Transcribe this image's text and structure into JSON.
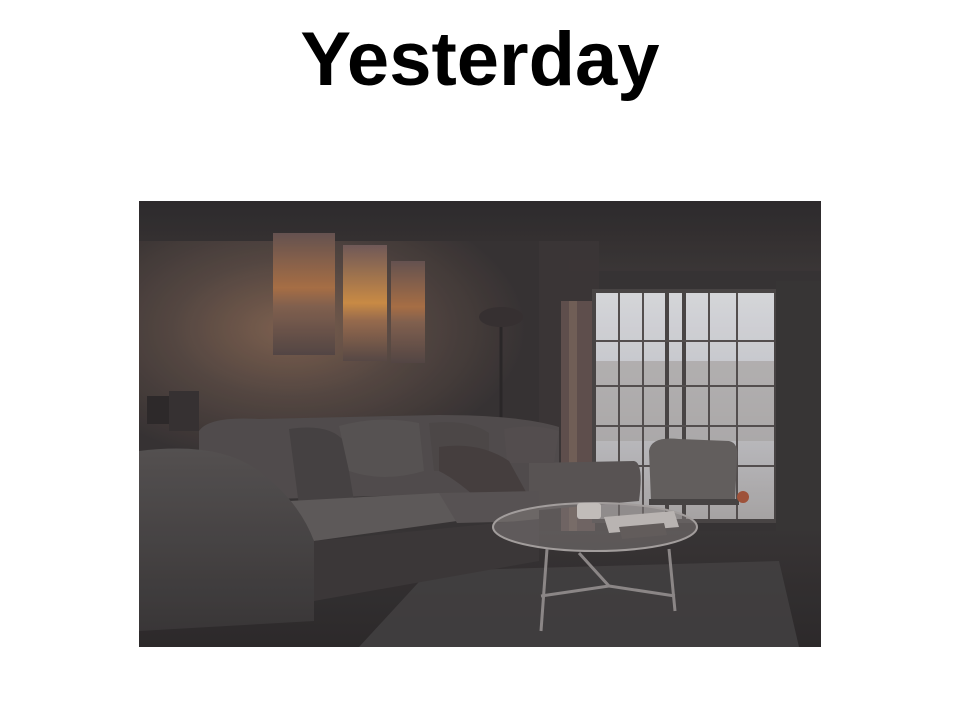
{
  "slide": {
    "title": "Yesterday",
    "image_subject": "living-room-photo"
  },
  "colors": {
    "background": "#ffffff",
    "title": "#000000",
    "room_shadow": "#3a3a3a",
    "sunset_glow": "#c9773a",
    "window_light": "#dfe3ea"
  }
}
